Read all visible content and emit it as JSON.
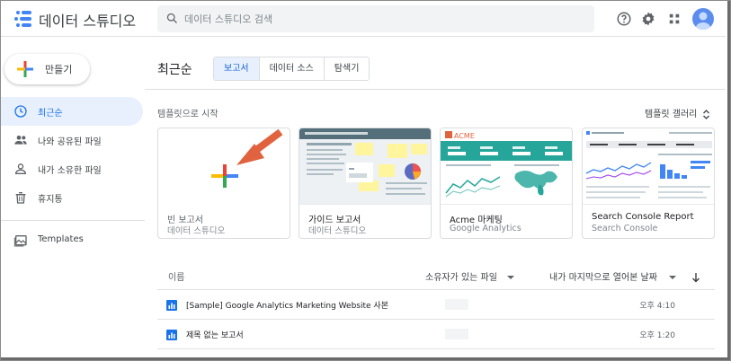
{
  "app": {
    "title": "데이터 스튜디오"
  },
  "search": {
    "placeholder": "데이터 스튜디오 검색"
  },
  "header_icons": [
    "help-icon",
    "settings-icon",
    "apps-grid-icon",
    "account-avatar"
  ],
  "sidebar": {
    "create_label": "만들기",
    "items": [
      {
        "label": "최근순",
        "icon": "clock-icon",
        "active": true
      },
      {
        "label": "나와 공유된 파일",
        "icon": "people-icon",
        "active": false
      },
      {
        "label": "내가 소유한 파일",
        "icon": "person-icon",
        "active": false
      },
      {
        "label": "휴지통",
        "icon": "trash-icon",
        "active": false
      },
      {
        "label": "Templates",
        "icon": "templates-icon",
        "active": false
      }
    ]
  },
  "main": {
    "title": "최근순",
    "tabs": [
      {
        "label": "보고서",
        "active": true
      },
      {
        "label": "데이터 소스",
        "active": false
      },
      {
        "label": "탐색기",
        "active": false
      }
    ],
    "templates_label": "템플릿으로 시작",
    "gallery_label": "템플릿 갤러리",
    "templates": [
      {
        "title": "빈 보고서",
        "subtitle": "데이터 스튜디오"
      },
      {
        "title": "가이드 보고서",
        "subtitle": "데이터 스튜디오"
      },
      {
        "title": "Acme 마케팅",
        "subtitle": "Google Analytics"
      },
      {
        "title": "Search Console Report",
        "subtitle": "Search Console"
      }
    ],
    "acme_logo": "ACME",
    "list": {
      "col_name": "이름",
      "col_owner": "소유자가 있는 파일",
      "col_opened": "내가 마지막으로 열어본 날짜",
      "rows": [
        {
          "name": "[Sample] Google Analytics Marketing Website 사본",
          "time": "오후 4:10"
        },
        {
          "name": "제목 없는 보고서",
          "time": "오후 1:20"
        }
      ]
    }
  },
  "colors": {
    "accent": "#1a73e8",
    "active_bg": "#e8f0fe",
    "arrow": "#e0623f"
  }
}
